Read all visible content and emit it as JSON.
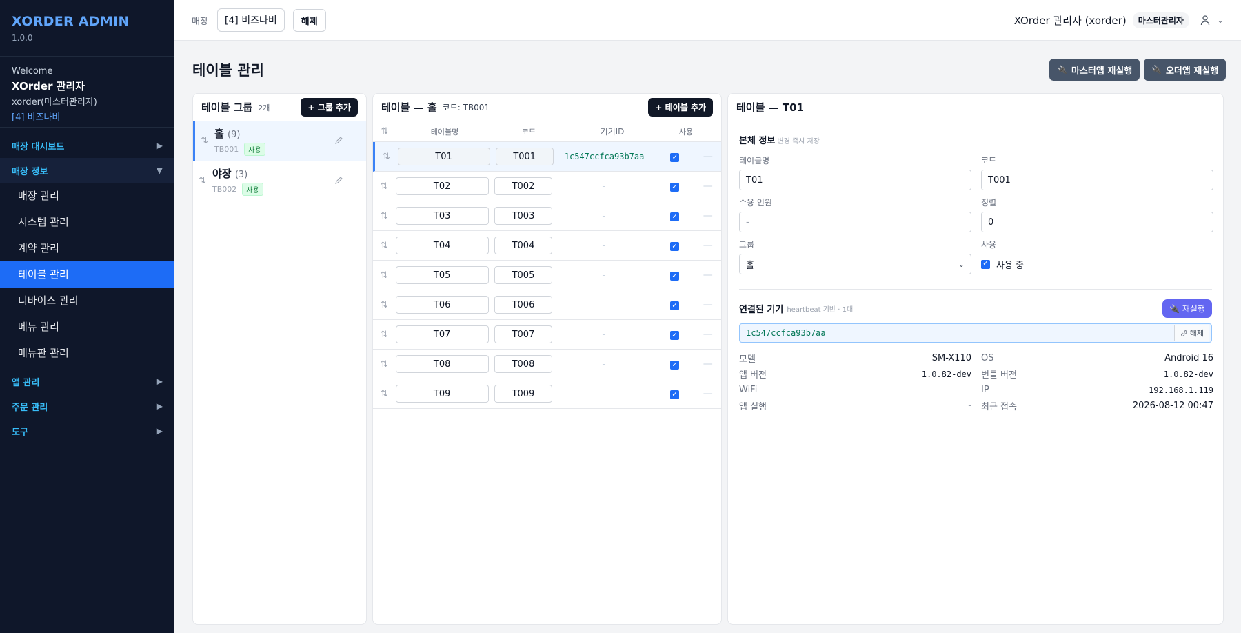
{
  "brand": {
    "title": "XORDER ADMIN",
    "version": "1.0.0"
  },
  "welcome": {
    "label": "Welcome",
    "name": "XOrder 관리자",
    "id": "xorder(마스터관리자)",
    "store": "[4] 비즈나비"
  },
  "sidebar": {
    "group1": {
      "label": "매장 대시보드",
      "arrow": "▶"
    },
    "group2": {
      "label": "매장 정보",
      "arrow": "▼"
    },
    "items": [
      {
        "label": "매장 관리"
      },
      {
        "label": "시스템 관리"
      },
      {
        "label": "계약 관리"
      },
      {
        "label": "테이블 관리"
      },
      {
        "label": "디바이스 관리"
      },
      {
        "label": "메뉴 관리"
      },
      {
        "label": "메뉴판 관리"
      }
    ],
    "group3": {
      "label": "앱 관리",
      "arrow": "▶"
    },
    "group4": {
      "label": "주문 관리",
      "arrow": "▶"
    },
    "group5": {
      "label": "도구",
      "arrow": "▶"
    }
  },
  "topbar": {
    "store_label": "매장",
    "store_value": "[4] 비즈나비",
    "release_label": "해제",
    "admin_name": "XOrder 관리자 (xorder)",
    "role": "마스터관리자",
    "chevron": "⌄"
  },
  "page": {
    "title": "테이블 관리",
    "master_restart": "마스터앱 재실행",
    "order_restart": "오더앱 재실행",
    "restart_icon": "🔌"
  },
  "groups_panel": {
    "title": "테이블 그룹",
    "count": "2개",
    "add_label": "+ 그룹 추가",
    "items": [
      {
        "name": "홀",
        "count": "(9)",
        "code": "TB001",
        "status": "사용"
      },
      {
        "name": "야장",
        "count": "(3)",
        "code": "TB002",
        "status": "사용"
      }
    ]
  },
  "tables_panel": {
    "title": "테이블 — 홀",
    "code_label": "코드: TB001",
    "add_label": "+ 테이블 추가",
    "headers": {
      "sort": "⇅",
      "name": "테이블명",
      "code": "코드",
      "device": "기기ID",
      "use": "사용"
    },
    "rows": [
      {
        "name": "T01",
        "code": "T001",
        "device": "1c547ccfca93b7aa"
      },
      {
        "name": "T02",
        "code": "T002",
        "device": "-"
      },
      {
        "name": "T03",
        "code": "T003",
        "device": "-"
      },
      {
        "name": "T04",
        "code": "T004",
        "device": "-"
      },
      {
        "name": "T05",
        "code": "T005",
        "device": "-"
      },
      {
        "name": "T06",
        "code": "T006",
        "device": "-"
      },
      {
        "name": "T07",
        "code": "T007",
        "device": "-"
      },
      {
        "name": "T08",
        "code": "T008",
        "device": "-"
      },
      {
        "name": "T09",
        "code": "T009",
        "device": "-"
      }
    ],
    "row_action": "—",
    "check": "✓"
  },
  "detail": {
    "title": "테이블 — T01",
    "section_title": "본체 정보",
    "section_hint": "변경 즉시 저장",
    "name_label": "테이블명",
    "name_value": "T01",
    "code_label": "코드",
    "code_value": "T001",
    "capacity_label": "수용 인원",
    "capacity_placeholder": "-",
    "sort_label": "정렬",
    "sort_value": "0",
    "group_label": "그룹",
    "group_value": "홀",
    "use_label": "사용",
    "use_check_label": "사용 중",
    "device_title": "연결된 기기",
    "device_hint": "heartbeat 기반 · 1대",
    "restart_label": "재실행",
    "device_id": "1c547ccfca93b7aa",
    "unlink_label": "해제",
    "info": {
      "model_k": "모델",
      "model_v": "SM-X110",
      "os_k": "OS",
      "os_v": "Android 16",
      "appver_k": "앱 버전",
      "appver_v": "1.0.82-dev",
      "bundle_k": "번들 버전",
      "bundle_v": "1.0.82-dev",
      "wifi_k": "WiFi",
      "wifi_v": "",
      "ip_k": "IP",
      "ip_v": "192.168.1.119",
      "apprun_k": "앱 실행",
      "apprun_v": "-",
      "lastseen_k": "최근 접속",
      "lastseen_v": "2026-08-12 00:47"
    }
  }
}
